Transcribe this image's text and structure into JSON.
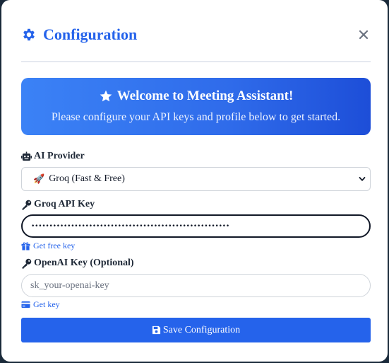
{
  "header": {
    "title": "Configuration",
    "gear_icon": "gear-icon",
    "close_icon": "close-icon"
  },
  "welcome": {
    "title": "Welcome to Meeting Assistant!",
    "subtitle": "Please configure your API keys and profile below to get started.",
    "icon": "star-icon"
  },
  "provider": {
    "label": "AI Provider",
    "icon": "robot-icon",
    "selected": "Groq (Fast & Free)",
    "selected_emoji": "🚀"
  },
  "groq": {
    "label": "Groq API Key",
    "icon": "key-icon",
    "value": "•••••••••••••••••••••••••••••••••••••••••••••••••••••••",
    "link_label": "Get free key",
    "link_icon": "gift-icon"
  },
  "openai": {
    "label": "OpenAI Key (Optional)",
    "icon": "key-icon",
    "placeholder": "sk_your-openai-key",
    "link_label": "Get key",
    "link_icon": "credit-card-icon"
  },
  "save": {
    "label": "Save Configuration",
    "icon": "save-icon"
  },
  "colors": {
    "accent": "#2563eb",
    "welcome_start": "#3b82f6",
    "welcome_end": "#1d4ed8"
  }
}
